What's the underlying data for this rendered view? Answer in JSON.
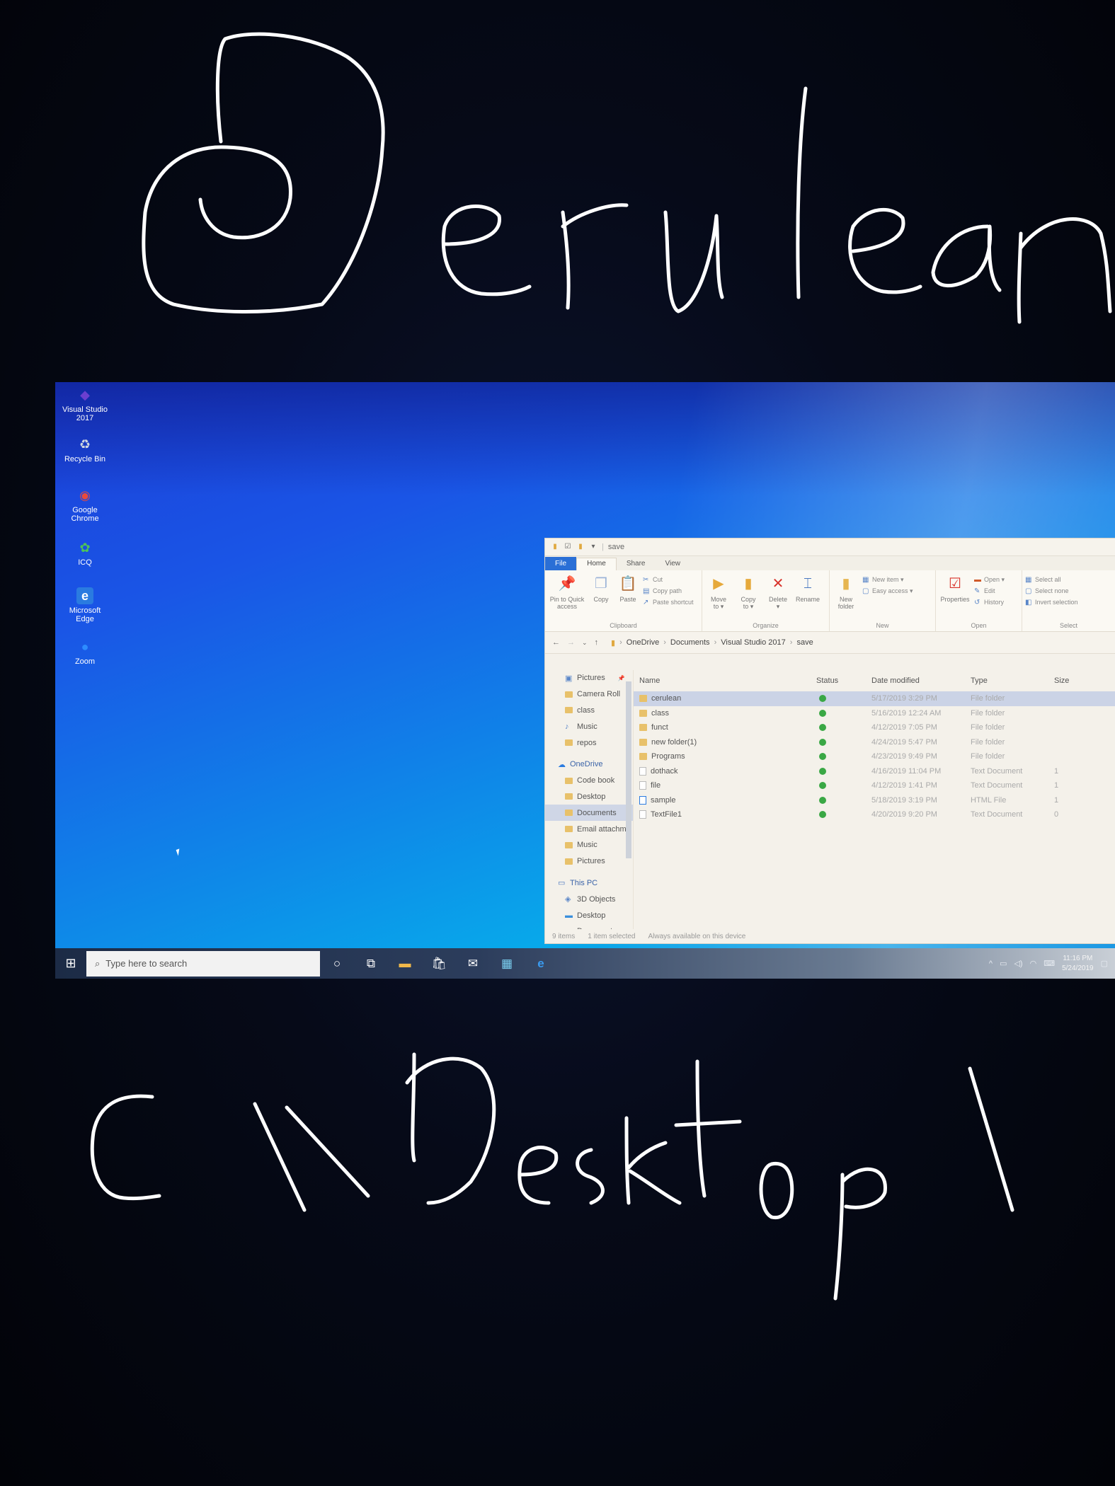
{
  "handwriting": {
    "top_text": "Cerulean",
    "bottom_text": "C:\\\\Desktop\\"
  },
  "desktop": {
    "icons": [
      {
        "label_line1": "Visual Studio",
        "label_line2": "2017",
        "icon": "visual-studio-icon",
        "glyph": "◆",
        "color": "#6b3fcf"
      },
      {
        "label_line1": "Recycle Bin",
        "label_line2": "",
        "icon": "recycle-bin-icon",
        "glyph": "♻",
        "color": "#cfd6e0"
      },
      {
        "label_line1": "Google",
        "label_line2": "Chrome",
        "icon": "chrome-icon",
        "glyph": "◉",
        "color": "#e84a3c"
      },
      {
        "label_line1": "ICQ",
        "label_line2": "",
        "icon": "icq-icon",
        "glyph": "✿",
        "color": "#4cc35a"
      },
      {
        "label_line1": "Microsoft",
        "label_line2": "Edge",
        "icon": "edge-icon",
        "glyph": "e",
        "color": "#2a7be0"
      },
      {
        "label_line1": "Zoom",
        "label_line2": "",
        "icon": "zoom-icon",
        "glyph": "●",
        "color": "#2d8cff"
      }
    ]
  },
  "explorer": {
    "title": "save",
    "tabs": [
      "File",
      "Home",
      "Share",
      "View"
    ],
    "ribbon": {
      "clipboard": {
        "pin_line1": "Pin to Quick",
        "pin_line2": "access",
        "copy": "Copy",
        "paste": "Paste",
        "cut": "Cut",
        "copy_path": "Copy path",
        "paste_shortcut": "Paste shortcut",
        "group": "Clipboard"
      },
      "organize": {
        "move_line1": "Move",
        "move_line2": "to ▾",
        "copy_line1": "Copy",
        "copy_line2": "to ▾",
        "delete_line1": "Delete",
        "delete_line2": "▾",
        "rename": "Rename",
        "group": "Organize"
      },
      "new": {
        "folder_line1": "New",
        "folder_line2": "folder",
        "new_item": "New item ▾",
        "easy_access": "Easy access ▾",
        "group": "New"
      },
      "open": {
        "properties": "Properties",
        "open": "Open ▾",
        "edit": "Edit",
        "history": "History",
        "group": "Open"
      },
      "select": {
        "select_all": "Select all",
        "select_none": "Select none",
        "invert": "Invert selection",
        "group": "Select"
      }
    },
    "breadcrumb": [
      "OneDrive",
      "Documents",
      "Visual Studio 2017",
      "save"
    ],
    "nav": [
      {
        "label": "Pictures",
        "kind": "pictures",
        "indent": 1,
        "pin": true
      },
      {
        "label": "Camera Roll",
        "kind": "folder",
        "indent": 1
      },
      {
        "label": "class",
        "kind": "folder",
        "indent": 1
      },
      {
        "label": "Music",
        "kind": "music",
        "indent": 1
      },
      {
        "label": "repos",
        "kind": "folder",
        "indent": 1
      },
      {
        "label": "",
        "kind": "spacer",
        "indent": 0
      },
      {
        "label": "OneDrive",
        "kind": "onedrive",
        "indent": 0
      },
      {
        "label": "Code book",
        "kind": "folder",
        "indent": 1
      },
      {
        "label": "Desktop",
        "kind": "folder",
        "indent": 1
      },
      {
        "label": "Documents",
        "kind": "folder",
        "indent": 1,
        "selected": true
      },
      {
        "label": "Email attachme",
        "kind": "folder",
        "indent": 1
      },
      {
        "label": "Music",
        "kind": "folder",
        "indent": 1
      },
      {
        "label": "Pictures",
        "kind": "folder",
        "indent": 1
      },
      {
        "label": "",
        "kind": "spacer",
        "indent": 0
      },
      {
        "label": "This PC",
        "kind": "pc",
        "indent": 0
      },
      {
        "label": "3D Objects",
        "kind": "objects",
        "indent": 1
      },
      {
        "label": "Desktop",
        "kind": "desktop",
        "indent": 1
      },
      {
        "label": "Documents",
        "kind": "doc",
        "indent": 1
      }
    ],
    "columns": {
      "name": "Name",
      "status": "Status",
      "date": "Date modified",
      "type": "Type",
      "size": "Size"
    },
    "files": [
      {
        "name": "cerulean",
        "kind": "folder",
        "date": "5/17/2019 3:29 PM",
        "type": "File folder",
        "size": "",
        "selected": true
      },
      {
        "name": "class",
        "kind": "folder",
        "date": "5/16/2019 12:24 AM",
        "type": "File folder",
        "size": ""
      },
      {
        "name": "funct",
        "kind": "folder",
        "date": "4/12/2019 7:05 PM",
        "type": "File folder",
        "size": ""
      },
      {
        "name": "new folder(1)",
        "kind": "folder",
        "date": "4/24/2019 5:47 PM",
        "type": "File folder",
        "size": ""
      },
      {
        "name": "Programs",
        "kind": "folder",
        "date": "4/23/2019 9:49 PM",
        "type": "File folder",
        "size": ""
      },
      {
        "name": "dothack",
        "kind": "doc",
        "date": "4/16/2019 11:04 PM",
        "type": "Text Document",
        "size": "1"
      },
      {
        "name": "file",
        "kind": "doc",
        "date": "4/12/2019 1:41 PM",
        "type": "Text Document",
        "size": "1"
      },
      {
        "name": "sample",
        "kind": "html",
        "date": "5/18/2019 3:19 PM",
        "type": "HTML File",
        "size": "1"
      },
      {
        "name": "TextFile1",
        "kind": "doc",
        "date": "4/20/2019 9:20 PM",
        "type": "Text Document",
        "size": "0"
      }
    ],
    "status": {
      "count": "9 items",
      "selected": "1 item selected",
      "availability": "Always available on this device"
    }
  },
  "taskbar": {
    "search_placeholder": "Type here to search",
    "clock_time": "11:16 PM",
    "clock_date": "5/24/2019"
  }
}
